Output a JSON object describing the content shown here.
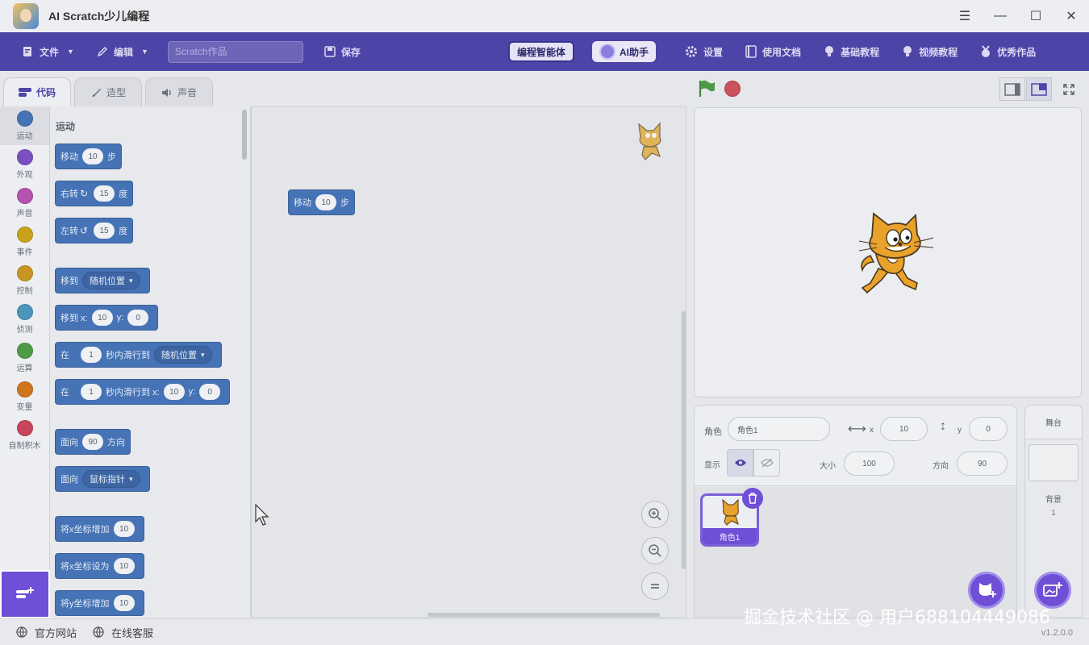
{
  "window": {
    "title": "AI Scratch少儿编程"
  },
  "menubar": {
    "file_label": "文件",
    "edit_label": "编辑",
    "project_placeholder": "Scratch作品",
    "save_label": "保存",
    "smart_body_label": "编程智能体",
    "ai_assistant_label": "AI助手",
    "settings_label": "设置",
    "docs_label": "使用文档",
    "basic_tutorial_label": "基础教程",
    "video_tutorial_label": "视频教程",
    "showcase_label": "优秀作品"
  },
  "tabs": [
    {
      "label": "代码",
      "active": true
    },
    {
      "label": "造型",
      "active": false
    },
    {
      "label": "声音",
      "active": false
    }
  ],
  "categories": [
    {
      "label": "运动",
      "color": "#4673b5"
    },
    {
      "label": "外观",
      "color": "#7b4fc0"
    },
    {
      "label": "声音",
      "color": "#b652b0"
    },
    {
      "label": "事件",
      "color": "#c9a21a"
    },
    {
      "label": "控制",
      "color": "#c89522"
    },
    {
      "label": "侦测",
      "color": "#4a95bc"
    },
    {
      "label": "运算",
      "color": "#4f9b45"
    },
    {
      "label": "变量",
      "color": "#d0741e"
    },
    {
      "label": "自制积木",
      "color": "#c9455c"
    }
  ],
  "palette": {
    "title": "运动",
    "blocks": {
      "move": {
        "a": "移动",
        "v": "10",
        "b": "步"
      },
      "turn_right": {
        "a": "右转",
        "v": "15",
        "b": "度"
      },
      "turn_left": {
        "a": "左转",
        "v": "15",
        "b": "度"
      },
      "goto": {
        "a": "移到",
        "d": "随机位置"
      },
      "goto_xy": {
        "a": "移到 x:",
        "x": "10",
        "y_label": "y:",
        "y": "0"
      },
      "glide_to": {
        "a": "在",
        "v": "1",
        "b": "秒内滑行到",
        "d": "随机位置"
      },
      "glide_xy": {
        "a": "在",
        "v": "1",
        "b": "秒内滑行到 x:",
        "x": "10",
        "y_label": "y:",
        "y": "0"
      },
      "point_dir": {
        "a": "面向",
        "v": "90",
        "b": "方向"
      },
      "point_towards": {
        "a": "面向",
        "d": "鼠标指针"
      },
      "change_x": {
        "a": "将x坐标增加",
        "v": "10"
      },
      "set_x": {
        "a": "将x坐标设为",
        "v": "10"
      },
      "change_y": {
        "a": "将y坐标增加",
        "v": "10"
      }
    }
  },
  "script_block": {
    "a": "移动",
    "v": "10",
    "b": "步"
  },
  "sprite_info": {
    "sprite_label": "角色",
    "sprite_name": "角色1",
    "x_label": "x",
    "x_value": "10",
    "y_label": "y",
    "y_value": "0",
    "show_label": "显示",
    "size_label": "大小",
    "size_value": "100",
    "direction_label": "方向",
    "direction_value": "90"
  },
  "sprites": [
    {
      "name": "角色1",
      "selected": true
    }
  ],
  "stage_panel": {
    "title": "舞台",
    "backdrop_label": "背景",
    "backdrop_count": "1"
  },
  "statusbar": {
    "official_site": "官方网站",
    "online_support": "在线客服",
    "version": "v1.2.0.0"
  },
  "watermark": "掘金技术社区 @ 用户688104449086",
  "colors": {
    "menubar": "#4c44a6",
    "accent": "#6f4fd6",
    "motion": "#4673b5"
  }
}
